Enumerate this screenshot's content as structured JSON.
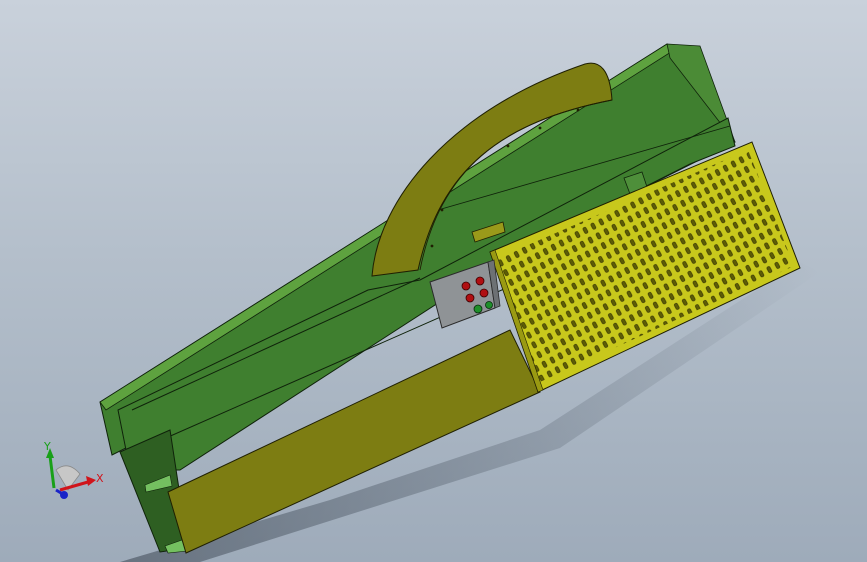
{
  "viewport": {
    "background_top": "#c9d1db",
    "background_bottom": "#9eabba"
  },
  "model": {
    "body_color": "#3f7f2f",
    "body_edge_color": "#0f220a",
    "panel_color": "#7d7d12",
    "guard_color": "#c8c81c",
    "control_box_color": "#8f9396",
    "indicator_red": "#b00f12",
    "indicator_green": "#1f8f2a"
  },
  "triad": {
    "x_label": "X",
    "y_label": "Y",
    "x_color": "#d0141b",
    "y_color": "#19a019",
    "z_color": "#1a24c8"
  }
}
